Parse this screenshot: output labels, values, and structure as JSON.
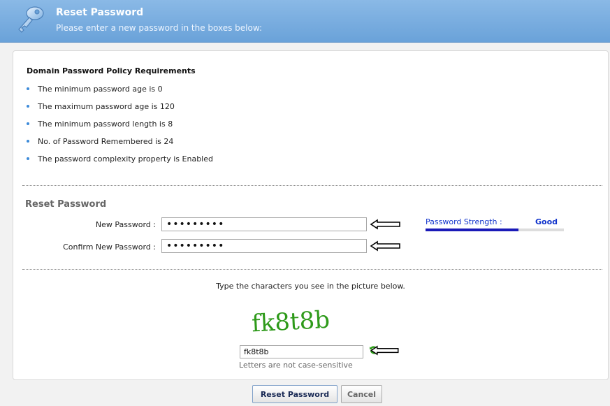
{
  "header": {
    "title": "Reset Password",
    "subtitle": "Please enter a new password in the boxes below:",
    "icon": "key-icon"
  },
  "policy": {
    "title": "Domain Password Policy Requirements",
    "items": [
      "The minimum password age is 0",
      "The maximum password age is 120",
      "The minimum password length is 8",
      "No. of Password Remembered is 24",
      "The password complexity property is Enabled"
    ]
  },
  "reset": {
    "heading": "Reset Password",
    "new_password_label": "New Password :",
    "new_password_value": "•••••••••",
    "confirm_password_label": "Confirm New Password :",
    "confirm_password_value": "•••••••••"
  },
  "strength": {
    "label": "Password Strength :",
    "value": "Good",
    "level": 0.67,
    "color": "#1a1ab8"
  },
  "captcha": {
    "instruction": "Type the characters you see in the picture below.",
    "image_text": "fk8t8b",
    "input_value": "fk8t8b",
    "note": "Letters are not case-sensitive"
  },
  "buttons": {
    "reset": "Reset Password",
    "cancel": "Cancel"
  }
}
